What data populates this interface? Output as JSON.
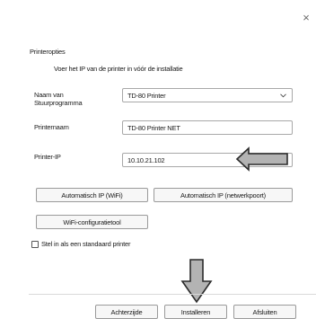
{
  "window": {
    "close_glyph": "×"
  },
  "section_title": "Printeropties",
  "subtitle": "Voer het IP van de printer in vóór de installatie",
  "fields": {
    "driver": {
      "label_line1": "Naam van",
      "label_line2": "Stuurprogramma",
      "value": "TD-80 Printer"
    },
    "printer_name": {
      "label": "Printernaam",
      "value": "TD-80 Printer NET"
    },
    "printer_ip": {
      "label": "Printer-IP",
      "value": "10.10.21.102"
    }
  },
  "buttons": {
    "auto_ip_wifi": "Automatisch IP (WiFi)",
    "auto_ip_network": "Automatisch IP (netwerkpoort)",
    "wifi_config": "WiFi-configuratietool",
    "back": "Achterzijde",
    "install": "Installeren",
    "close": "Afsluiten"
  },
  "checkbox": {
    "label": "Stel in als een standaard printer",
    "checked": false
  },
  "annotations": {
    "arrow_color": "#b3b3b3",
    "arrow_stroke": "#2b2b2b"
  }
}
